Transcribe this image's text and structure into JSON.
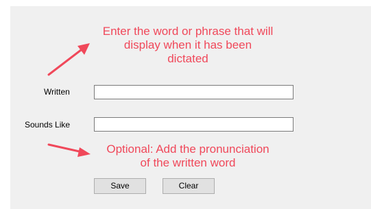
{
  "annotations": {
    "top_line1": "Enter the word or phrase that will",
    "top_line2": "display when it has been",
    "top_line3": "dictated",
    "bottom_line1": "Optional: Add the pronunciation",
    "bottom_line2": "of the written word"
  },
  "form": {
    "written_label": "Written",
    "written_value": "",
    "sounds_like_label": "Sounds Like",
    "sounds_like_value": ""
  },
  "buttons": {
    "save_label": "Save",
    "clear_label": "Clear"
  },
  "colors": {
    "annotation": "#f0485a",
    "panel_background": "#f0f0f0",
    "button_background": "#e1e1e1"
  },
  "icons": {
    "top_arrow": "arrow-up-right-icon",
    "bottom_arrow": "arrow-down-right-icon"
  }
}
